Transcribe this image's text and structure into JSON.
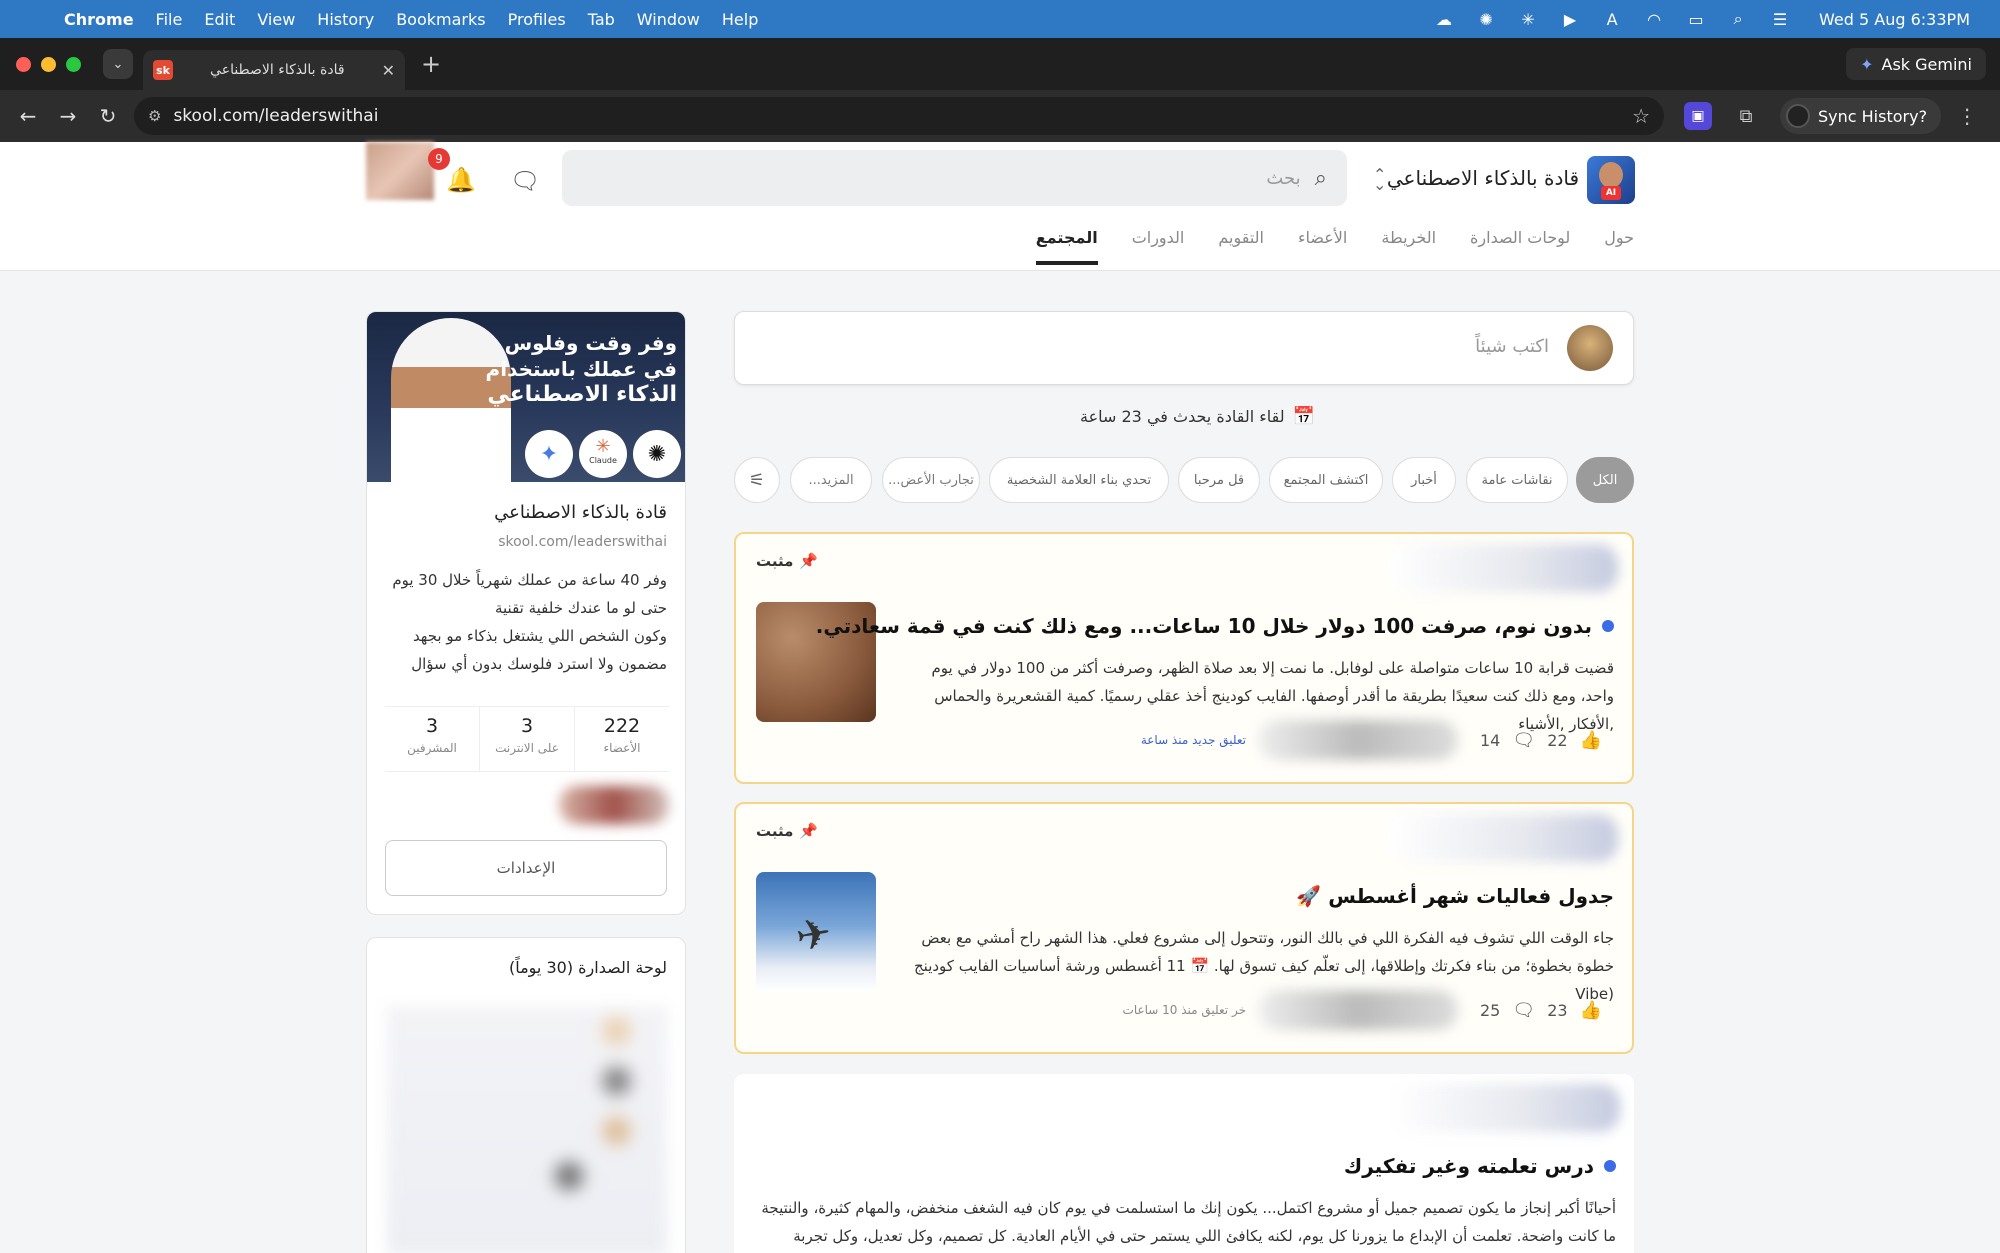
{
  "menubar": {
    "app": "Chrome",
    "items": [
      "File",
      "Edit",
      "View",
      "History",
      "Bookmarks",
      "Profiles",
      "Tab",
      "Window",
      "Help"
    ],
    "clock": "Wed 5 Aug  6:33PM",
    "status_icons": [
      "creative-cloud-icon",
      "chatgpt-icon",
      "claude-icon",
      "play-icon",
      "keyboard-a-icon",
      "wifi-icon",
      "battery-icon",
      "spotlight-icon",
      "control-center-icon"
    ]
  },
  "browser": {
    "tab_title": "قادة بالذكاء الاصطناعي",
    "tab_favicon": "sk",
    "ask_gemini": "Ask Gemini",
    "url": "skool.com/leaderswithai",
    "sync_label": "Sync History?"
  },
  "header": {
    "group_name": "قادة بالذكاء الاصطناعي",
    "search_placeholder": "بحث",
    "notif_count": "9",
    "tabs": [
      "المجتمع",
      "الدورات",
      "التقويم",
      "الأعضاء",
      "الخريطة",
      "لوحات الصدارة",
      "حول"
    ],
    "active_tab": 0
  },
  "feed": {
    "composer_placeholder": "اكتب شيئاً",
    "event_text": "لقاء القادة يحدث في 23 ساعة",
    "chips": [
      "الكل",
      "نقاشات عامة",
      "أخبار",
      "اكتشف المجتمع",
      "قل مرحبا",
      "تحدي بناء العلامة الشخصية",
      "تجارب الأعض...",
      "المزيد..."
    ],
    "posts": [
      {
        "pinned_label": "مثبت",
        "title": "بدون نوم، صرفت 100 دولار خلال 10 ساعات... ومع ذلك كنت في قمة سعادتي.",
        "body": "قضيت قرابة 10 ساعات متواصلة على لوفابل. ما نمت إلا بعد صلاة الظهر، وصرفت أكثر من 100 دولار في يوم واحد، ومع ذلك كنت سعيدًا بطريقة ما أقدر أوصفها. الفايب كودينج أخذ عقلي رسميًا. كمية القشعريرة والحماس ,الأفكار ,الأشياء",
        "likes": "22",
        "comments": "14",
        "last_comment": "تعليق جديد منذ ساعة"
      },
      {
        "pinned_label": "مثبت",
        "title": "جدول فعاليات شهر أغسطس 🚀",
        "body": "جاء الوقت اللي تشوف فيه الفكرة اللي في بالك النور، وتتحول إلى مشروع فعلي. هذا الشهر راح أمشي مع بعض خطوة بخطوة؛ من بناء فكرتك وإطلاقها، إلى تعلّم كيف تسوق لها. 📅 11 أغسطس ورشة أساسيات الفايب كودينج (Vibe",
        "likes": "23",
        "comments": "25",
        "last_comment": "خر تعليق منذ 10 ساعات"
      },
      {
        "title": "درس تعلمته وغير تفكيرك",
        "body": "أحيانًا أكبر إنجاز ما يكون تصميم جميل أو مشروع اكتمل... يكون إنك ما استسلمت في يوم كان فيه الشغف منخفض، والمهام كثيرة، والنتيجة ما كانت واضحة. تعلمت أن الإبداع ما يزورنا كل يوم، لكنه يكافئ اللي يستمر حتى في الأيام العادية. كل تصميم، وكل تعديل، وكل تجربة فاشلة... هي"
      }
    ]
  },
  "sidebar": {
    "banner_line1": "وفر وقت وفلوس",
    "banner_line2": "في عملك باستخدام",
    "banner_line3": "الذكاء الاصطناعي",
    "banner_logo_label": "Claude",
    "group_name": "قادة بالذكاء الاصطناعي",
    "group_url": "skool.com/leaderswithai",
    "description": [
      "وفر 40 ساعة من عملك شهرياً خلال 30 يوم",
      "حتى لو ما عندك خلفية تقنية",
      "وكون الشخص اللي يشتغل بذكاء مو بجهد",
      "مضمون ولا استرد فلوسك بدون أي سؤال"
    ],
    "stats": [
      {
        "value": "222",
        "label": "الأعضاء"
      },
      {
        "value": "3",
        "label": "على الانترنت"
      },
      {
        "value": "3",
        "label": "المشرفين"
      }
    ],
    "settings_label": "الإعدادات",
    "leaderboard_title": "لوحة الصدارة (30 يوماً)"
  }
}
